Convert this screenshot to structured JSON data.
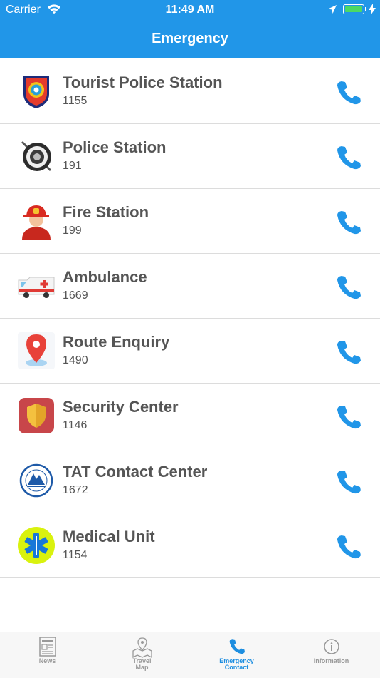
{
  "status_bar": {
    "carrier": "Carrier",
    "time": "11:49 AM"
  },
  "header": {
    "title": "Emergency"
  },
  "contacts": [
    {
      "name": "Tourist Police Station",
      "number": "1155",
      "icon": "tourist-police-badge-icon"
    },
    {
      "name": "Police Station",
      "number": "191",
      "icon": "police-seal-icon"
    },
    {
      "name": "Fire Station",
      "number": "199",
      "icon": "firefighter-icon"
    },
    {
      "name": "Ambulance",
      "number": "1669",
      "icon": "ambulance-icon"
    },
    {
      "name": "Route Enquiry",
      "number": "1490",
      "icon": "map-pin-icon"
    },
    {
      "name": "Security Center",
      "number": "1146",
      "icon": "shield-icon"
    },
    {
      "name": "TAT Contact Center",
      "number": "1672",
      "icon": "tat-logo-icon"
    },
    {
      "name": "Medical Unit",
      "number": "1154",
      "icon": "star-of-life-icon"
    }
  ],
  "tabs": [
    {
      "label": "News",
      "icon": "newspaper-icon"
    },
    {
      "label": "Travel Map",
      "line1": "Travel",
      "line2": "Map",
      "icon": "map-icon"
    },
    {
      "label": "Emergency Contact",
      "line1": "Emergency",
      "line2": "Contact",
      "icon": "phone-icon",
      "active": true
    },
    {
      "label": "Information",
      "icon": "info-icon"
    }
  ],
  "colors": {
    "header": "#2196e8",
    "accent": "#1e8ee0",
    "battery": "#4cd964"
  }
}
